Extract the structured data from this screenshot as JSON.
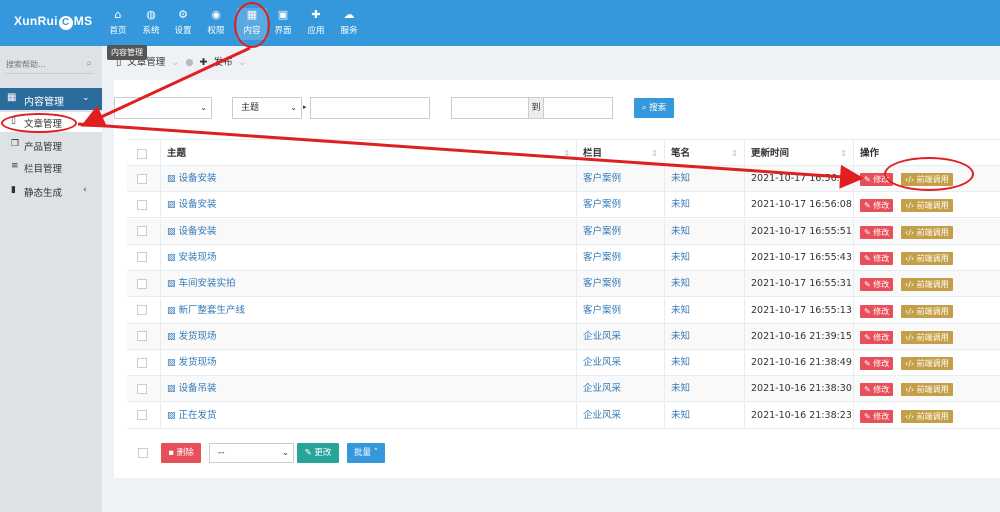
{
  "app": {
    "logo_left": "XunRui",
    "logo_c": "C",
    "logo_right": "MS"
  },
  "top_nav": [
    {
      "label": "首页",
      "icon": "home-icon",
      "glyph": "⌂"
    },
    {
      "label": "系统",
      "icon": "globe-icon",
      "glyph": "◍"
    },
    {
      "label": "设置",
      "icon": "cogs-icon",
      "glyph": "⚙"
    },
    {
      "label": "权限",
      "icon": "user-icon",
      "glyph": "◉"
    },
    {
      "label": "内容",
      "icon": "grid-icon",
      "glyph": "▦"
    },
    {
      "label": "界面",
      "icon": "html5-icon",
      "glyph": "▣"
    },
    {
      "label": "应用",
      "icon": "puzzle-icon",
      "glyph": "✚"
    },
    {
      "label": "服务",
      "icon": "cloud-icon",
      "glyph": "☁"
    }
  ],
  "sidebar": {
    "search_placeholder": "搜索帮助...",
    "section_title": "内容管理",
    "tooltip": "内容管理",
    "items": [
      {
        "label": "文章管理"
      },
      {
        "label": "产品管理"
      },
      {
        "label": "栏目管理"
      },
      {
        "label": "静态生成"
      }
    ]
  },
  "breadcrumb": {
    "item1": "文章管理",
    "item2": "发布"
  },
  "filters": {
    "field_select": "主题",
    "range_sep": "到",
    "search_button": "搜索"
  },
  "table": {
    "headers": {
      "title": "主题",
      "category": "栏目",
      "author": "笔名",
      "updated": "更新时间",
      "actions": "操作"
    },
    "edit_label": "修改",
    "front_label": "前端调用",
    "rows": [
      {
        "title": "设备安装",
        "category": "客户案例",
        "author": "未知",
        "updated": "2021-10-17 16:56:27"
      },
      {
        "title": "设备安装",
        "category": "客户案例",
        "author": "未知",
        "updated": "2021-10-17 16:56:08"
      },
      {
        "title": "设备安装",
        "category": "客户案例",
        "author": "未知",
        "updated": "2021-10-17 16:55:51"
      },
      {
        "title": "安装现场",
        "category": "客户案例",
        "author": "未知",
        "updated": "2021-10-17 16:55:43"
      },
      {
        "title": "车间安装实拍",
        "category": "客户案例",
        "author": "未知",
        "updated": "2021-10-17 16:55:31"
      },
      {
        "title": "新厂整套生产线",
        "category": "客户案例",
        "author": "未知",
        "updated": "2021-10-17 16:55:13"
      },
      {
        "title": "发货现场",
        "category": "企业风采",
        "author": "未知",
        "updated": "2021-10-16 21:39:15"
      },
      {
        "title": "发货现场",
        "category": "企业风采",
        "author": "未知",
        "updated": "2021-10-16 21:38:49"
      },
      {
        "title": "设备吊装",
        "category": "企业风采",
        "author": "未知",
        "updated": "2021-10-16 21:38:30"
      },
      {
        "title": "正在发货",
        "category": "企业风采",
        "author": "未知",
        "updated": "2021-10-16 21:38:23"
      }
    ]
  },
  "bottom": {
    "delete_label": "删除",
    "select_value": "--",
    "change_label": "更改",
    "batch_label": "批量"
  },
  "colors": {
    "primary": "#3598dc",
    "sidebar_active": "#2b6c9c",
    "danger": "#e7505a",
    "gold": "#c49f47",
    "teal": "#26a69a",
    "annotation": "#e02020"
  }
}
